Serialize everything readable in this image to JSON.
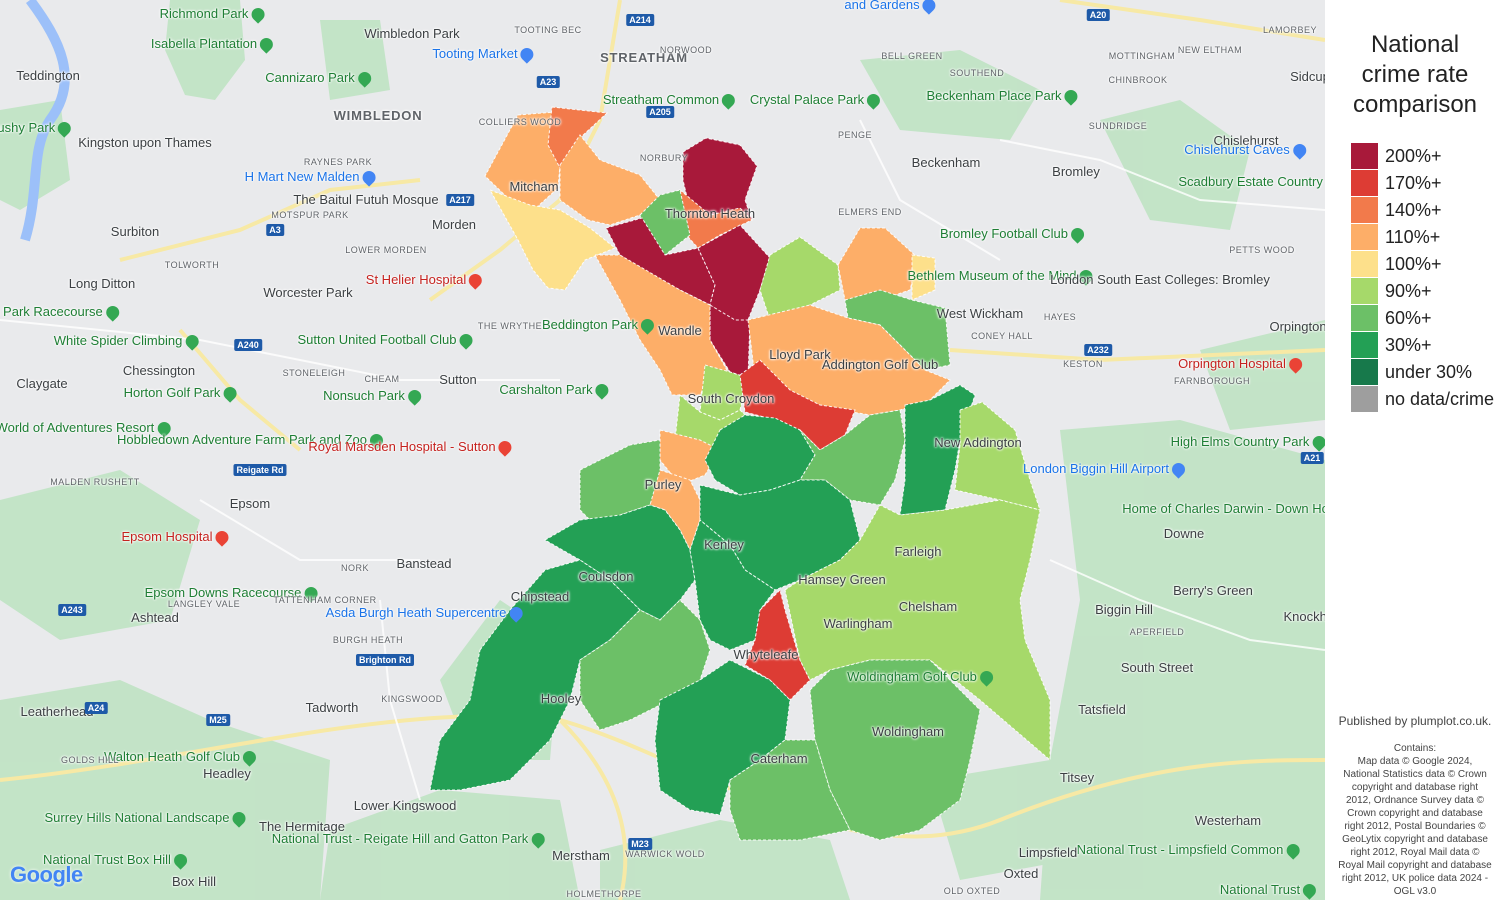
{
  "legend": {
    "title_lines": [
      "National",
      "crime rate",
      "comparison"
    ],
    "items": [
      {
        "label": "200%+",
        "color": "#a8193a"
      },
      {
        "label": "170%+",
        "color": "#dd3c34"
      },
      {
        "label": "140%+",
        "color": "#f27a4b"
      },
      {
        "label": "110%+",
        "color": "#fdae68"
      },
      {
        "label": "100%+",
        "color": "#fde08b"
      },
      {
        "label": "90%+",
        "color": "#a6d96a"
      },
      {
        "label": "60%+",
        "color": "#6cc067"
      },
      {
        "label": "30%+",
        "color": "#23a055"
      },
      {
        "label": "under 30%",
        "color": "#17794b"
      },
      {
        "label": "no data/crime",
        "color": "#9e9e9e"
      }
    ]
  },
  "credits": {
    "published": "Published by plumplot.co.uk.",
    "contains_lines": [
      "Contains:",
      "Map data © Google 2024,",
      "National Statistics data © Crown",
      "copyright and database right",
      "2012, Ordnance Survey data ©",
      "Crown copyright and database",
      "right 2012, Postal Boundaries ©",
      "GeoLytix copyright and database",
      "right 2012, Royal Mail data ©",
      "Royal Mail copyright and database",
      "right 2012, UK police data 2024 -",
      "OGL v3.0"
    ]
  },
  "map": {
    "google_logo": "Google",
    "places": [
      {
        "name": "Richmond Park",
        "cls": "green"
      },
      {
        "name": "Isabella Plantation",
        "cls": "green"
      },
      {
        "name": "Teddington",
        "cls": ""
      },
      {
        "name": "Wimbledon Park",
        "cls": ""
      },
      {
        "name": "Tooting Market",
        "cls": "blue"
      },
      {
        "name": "TOOTING BEC",
        "cls": "small"
      },
      {
        "name": "STREATHAM",
        "cls": "town"
      },
      {
        "name": "NORWOOD",
        "cls": "small"
      },
      {
        "name": "and Gardens",
        "cls": "blue"
      },
      {
        "name": "BELL GREEN",
        "cls": "small"
      },
      {
        "name": "MOTTINGHAM",
        "cls": "small"
      },
      {
        "name": "NEW ELTHAM",
        "cls": "small"
      },
      {
        "name": "CHINBROOK",
        "cls": "small"
      },
      {
        "name": "LAMORBEY",
        "cls": "small"
      },
      {
        "name": "Sidcup",
        "cls": ""
      },
      {
        "name": "Cannizaro Park",
        "cls": "green"
      },
      {
        "name": "WIMBLEDON",
        "cls": "town"
      },
      {
        "name": "Streatham Common",
        "cls": "green"
      },
      {
        "name": "Crystal Palace Park",
        "cls": "green"
      },
      {
        "name": "SOUTHEND",
        "cls": "small"
      },
      {
        "name": "Beckenham Place Park",
        "cls": "green"
      },
      {
        "name": "Kingston upon Thames",
        "cls": ""
      },
      {
        "name": "Bushy Park",
        "cls": "green"
      },
      {
        "name": "COLLIERS WOOD",
        "cls": "small"
      },
      {
        "name": "NORBURY",
        "cls": "small"
      },
      {
        "name": "PENGE",
        "cls": "small"
      },
      {
        "name": "SUNDRIDGE",
        "cls": "small"
      },
      {
        "name": "Chislehurst",
        "cls": ""
      },
      {
        "name": "RAYNES PARK",
        "cls": "small"
      },
      {
        "name": "H Mart New Malden",
        "cls": "blue"
      },
      {
        "name": "Beckenham",
        "cls": ""
      },
      {
        "name": "Chislehurst Caves",
        "cls": "blue"
      },
      {
        "name": "Bromley",
        "cls": ""
      },
      {
        "name": "Scadbury Estate Country Pk",
        "cls": "green"
      },
      {
        "name": "The Baitul Futuh Mosque",
        "cls": ""
      },
      {
        "name": "MOTSPUR PARK",
        "cls": "small"
      },
      {
        "name": "Morden",
        "cls": ""
      },
      {
        "name": "ELMERS END",
        "cls": "small"
      },
      {
        "name": "Surbiton",
        "cls": ""
      },
      {
        "name": "Bromley Football Club",
        "cls": "green"
      },
      {
        "name": "PETTS WOOD",
        "cls": "small"
      },
      {
        "name": "LOWER MORDEN",
        "cls": "small"
      },
      {
        "name": "Bethlem Museum of the Mind",
        "cls": "green"
      },
      {
        "name": "London South East Colleges: Bromley",
        "cls": ""
      },
      {
        "name": "Long Ditton",
        "cls": ""
      },
      {
        "name": "Worcester Park",
        "cls": ""
      },
      {
        "name": "St Helier Hospital",
        "cls": "red"
      },
      {
        "name": "TOLWORTH",
        "cls": "small"
      },
      {
        "name": "West Wickham",
        "cls": ""
      },
      {
        "name": "HAYES",
        "cls": "small"
      },
      {
        "name": "CONEY HALL",
        "cls": "small"
      },
      {
        "name": "Sandown Park Racecourse",
        "cls": "green"
      },
      {
        "name": "THE WRYTHE",
        "cls": "small"
      },
      {
        "name": "Beddington Park",
        "cls": "green"
      },
      {
        "name": "White Spider Climbing",
        "cls": "green"
      },
      {
        "name": "Sutton United Football Club",
        "cls": "green"
      },
      {
        "name": "Orpington",
        "cls": ""
      },
      {
        "name": "Chessington",
        "cls": ""
      },
      {
        "name": "STONELEIGH",
        "cls": "small"
      },
      {
        "name": "CHEAM",
        "cls": "small"
      },
      {
        "name": "Sutton",
        "cls": ""
      },
      {
        "name": "Carshalton Park",
        "cls": "green"
      },
      {
        "name": "KESTON",
        "cls": "small"
      },
      {
        "name": "Orpington Hospital",
        "cls": "red"
      },
      {
        "name": "FARNBOROUGH",
        "cls": "small"
      },
      {
        "name": "Claygate",
        "cls": ""
      },
      {
        "name": "Horton Golf Park",
        "cls": "green"
      },
      {
        "name": "Nonsuch Park",
        "cls": "green"
      },
      {
        "name": "Chessington World of Adventures Resort",
        "cls": "green"
      },
      {
        "name": "Hobbledown Adventure Farm Park and Zoo",
        "cls": "green"
      },
      {
        "name": "Royal Marsden Hospital - Sutton",
        "cls": "red"
      },
      {
        "name": "New Addington",
        "cls": ""
      },
      {
        "name": "High Elms Country Park",
        "cls": "green"
      },
      {
        "name": "London Biggin Hill Airport",
        "cls": "blue"
      },
      {
        "name": "MALDEN RUSHETT",
        "cls": "small"
      },
      {
        "name": "Epsom",
        "cls": ""
      },
      {
        "name": "Home of Charles Darwin - Down House",
        "cls": "green"
      },
      {
        "name": "Epsom Hospital",
        "cls": "red"
      },
      {
        "name": "Downe",
        "cls": ""
      },
      {
        "name": "Banstead",
        "cls": ""
      },
      {
        "name": "NORK",
        "cls": "small"
      },
      {
        "name": "Kenley",
        "cls": ""
      },
      {
        "name": "Coulsdon",
        "cls": ""
      },
      {
        "name": "Farleigh",
        "cls": ""
      },
      {
        "name": "Epsom Downs Racecourse",
        "cls": "green"
      },
      {
        "name": "Chipstead",
        "cls": ""
      },
      {
        "name": "Hamsey Green",
        "cls": ""
      },
      {
        "name": "Chelsham",
        "cls": ""
      },
      {
        "name": "Biggin Hill",
        "cls": ""
      },
      {
        "name": "Berry's Green",
        "cls": ""
      },
      {
        "name": "Ashtead",
        "cls": ""
      },
      {
        "name": "Asda Burgh Heath Supercentre",
        "cls": "blue"
      },
      {
        "name": "TATTENHAM CORNER",
        "cls": "small"
      },
      {
        "name": "LANGLEY VALE",
        "cls": "small"
      },
      {
        "name": "BURGH HEATH",
        "cls": "small"
      },
      {
        "name": "Warlingham",
        "cls": ""
      },
      {
        "name": "APERFIELD",
        "cls": "small"
      },
      {
        "name": "Knockholt",
        "cls": ""
      },
      {
        "name": "Whyteleafe",
        "cls": ""
      },
      {
        "name": "South Street",
        "cls": ""
      },
      {
        "name": "Leatherhead",
        "cls": ""
      },
      {
        "name": "KINGSWOOD",
        "cls": "small"
      },
      {
        "name": "Hooley",
        "cls": ""
      },
      {
        "name": "Woldingham Golf Club",
        "cls": "green"
      },
      {
        "name": "Tadworth",
        "cls": ""
      },
      {
        "name": "Tatsfield",
        "cls": ""
      },
      {
        "name": "Woldingham",
        "cls": ""
      },
      {
        "name": "Caterham",
        "cls": ""
      },
      {
        "name": "Walton Heath Golf Club",
        "cls": "green"
      },
      {
        "name": "GOLDS HILL",
        "cls": "small"
      },
      {
        "name": "Headley",
        "cls": ""
      },
      {
        "name": "Titsey",
        "cls": ""
      },
      {
        "name": "Lower Kingswood",
        "cls": ""
      },
      {
        "name": "Surrey Hills National Landscape",
        "cls": "green"
      },
      {
        "name": "Westerham",
        "cls": ""
      },
      {
        "name": "The Hermitage",
        "cls": ""
      },
      {
        "name": "National Trust - Limpsfield Common",
        "cls": "green"
      },
      {
        "name": "National Trust Box Hill",
        "cls": "green"
      },
      {
        "name": "National Trust - Reigate Hill and Gatton Park",
        "cls": "green"
      },
      {
        "name": "Merstham",
        "cls": ""
      },
      {
        "name": "WARWICK WOLD",
        "cls": "small"
      },
      {
        "name": "Limpsfield",
        "cls": ""
      },
      {
        "name": "Oxted",
        "cls": ""
      },
      {
        "name": "Box Hill",
        "cls": ""
      },
      {
        "name": "HOLMETHORPE",
        "cls": "small"
      },
      {
        "name": "OLD OXTED",
        "cls": "small"
      },
      {
        "name": "National Trust",
        "cls": "green"
      },
      {
        "name": "Mitcham",
        "cls": ""
      },
      {
        "name": "Thornton Heath",
        "cls": ""
      },
      {
        "name": "South Croydon",
        "cls": ""
      },
      {
        "name": "Lloyd Park",
        "cls": ""
      },
      {
        "name": "Addington Golf Club",
        "cls": ""
      },
      {
        "name": "Wandle",
        "cls": ""
      },
      {
        "name": "Purley",
        "cls": ""
      }
    ],
    "roads": [
      "A3",
      "A240",
      "A24",
      "A243",
      "M25",
      "M23",
      "A232",
      "A20",
      "A21",
      "A205",
      "A23",
      "A214",
      "A217",
      "Reigate Rd",
      "Brighton Rd"
    ]
  }
}
